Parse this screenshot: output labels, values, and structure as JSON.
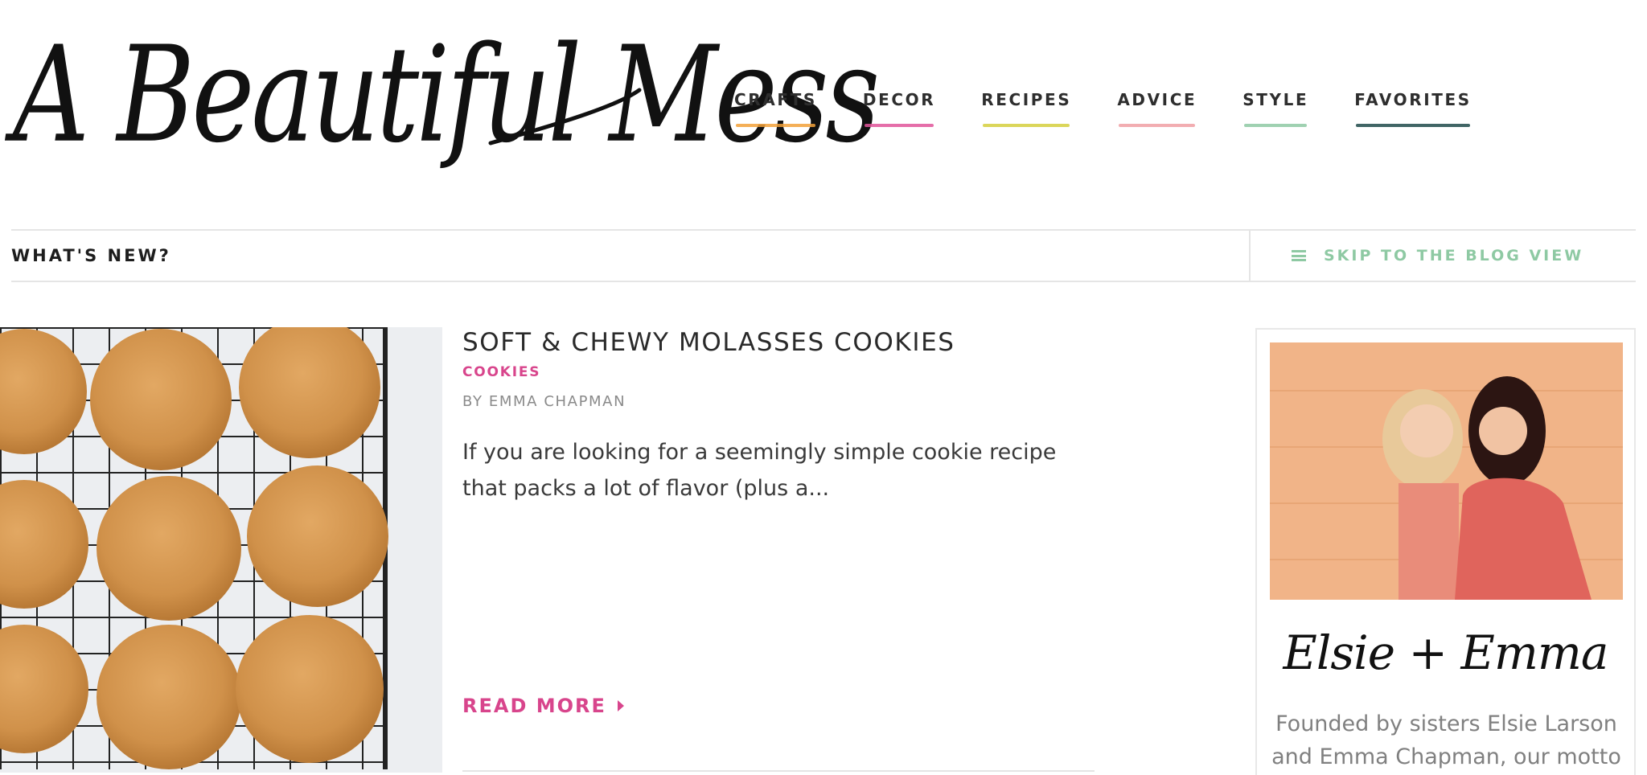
{
  "site": {
    "logo_text": "A Beautiful Mess"
  },
  "nav": {
    "items": [
      {
        "label": "CRAFTS",
        "color": "#f2a13a"
      },
      {
        "label": "DECOR",
        "color": "#e0559a"
      },
      {
        "label": "RECIPES",
        "color": "#d5cf3d"
      },
      {
        "label": "ADVICE",
        "color": "#f09fa3"
      },
      {
        "label": "STYLE",
        "color": "#8ec9a3"
      },
      {
        "label": "FAVORITES",
        "color": "#1f4a4a"
      }
    ]
  },
  "whats_new": {
    "title": "WHAT'S NEW?",
    "skip_label": "SKIP TO THE BLOG VIEW",
    "skip_icon": "hamburger-menu-icon"
  },
  "featured_post": {
    "title": "SOFT & CHEWY MOLASSES COOKIES",
    "category": "COOKIES",
    "author": "BY EMMA CHAPMAN",
    "excerpt": "If you are looking for a seemingly simple cookie recipe that packs a lot of flavor (plus a...",
    "read_more": "READ MORE",
    "image_alt": "molasses cookies on cooling rack"
  },
  "sidebar": {
    "signature": "Elsie + Emma",
    "description": "Founded by sisters Elsie Larson and Emma Chapman, our motto"
  },
  "colors": {
    "accent_pink": "#d8458c",
    "accent_green": "#8ec9a3",
    "border": "#e5e5e5"
  }
}
